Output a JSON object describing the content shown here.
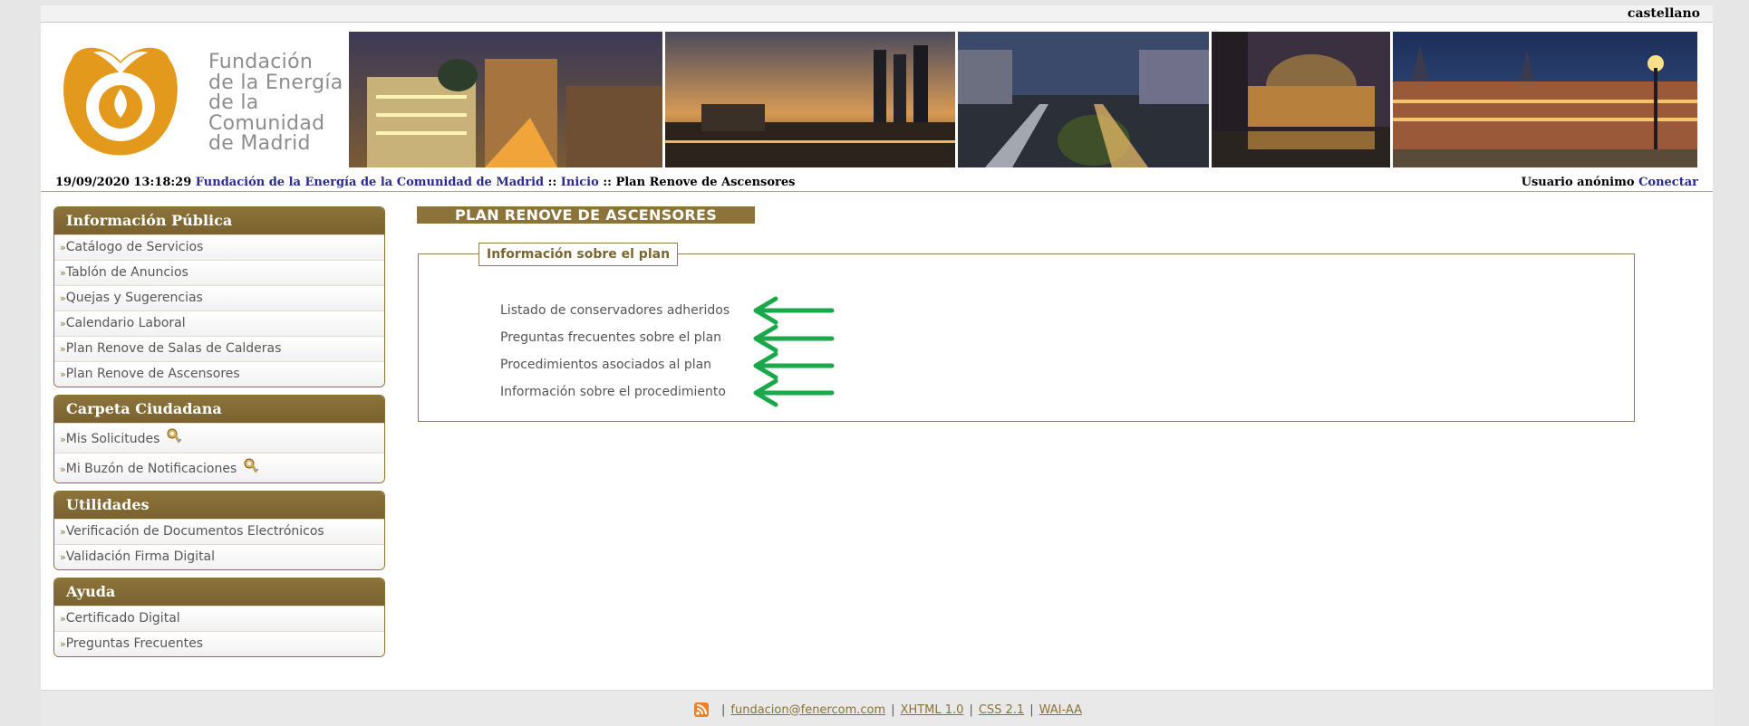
{
  "header": {
    "language_link": "castellano",
    "logo_text": "Fundación\nde la Energía\nde la\nComunidad\nde Madrid",
    "datetime": "19/09/2020 13:18:29",
    "breadcrumb": {
      "home_link": "Fundación de la Energía de la Comunidad de Madrid",
      "sep1": " :: ",
      "inicio_link": "Inicio",
      "sep2": " :: ",
      "current": "Plan Renove de Ascensores"
    },
    "user_label": "Usuario anónimo",
    "login_link": "Conectar"
  },
  "sidebar": {
    "bullet": "»",
    "panels": [
      {
        "title": "Información Pública",
        "items": [
          "Catálogo de Servicios",
          "Tablón de Anuncios",
          "Quejas y Sugerencias",
          "Calendario Laboral",
          "Plan Renove de Salas de Calderas",
          "Plan Renove de Ascensores"
        ]
      },
      {
        "title": "Carpeta Ciudadana",
        "items": [
          "Mis Solicitudes",
          "Mi Buzón de Notificaciones"
        ]
      },
      {
        "title": "Utilidades",
        "items": [
          "Verificación de Documentos Electrónicos",
          "Validación Firma Digital"
        ]
      },
      {
        "title": "Ayuda",
        "items": [
          "Certificado Digital",
          "Preguntas Frecuentes"
        ]
      }
    ]
  },
  "main": {
    "title": "PLAN RENOVE DE ASCENSORES",
    "box_legend": "Información sobre el plan",
    "links": [
      "Listado de conservadores adheridos",
      "Preguntas frecuentes sobre el plan",
      "Procedimientos asociados al plan",
      "Información sobre el procedimiento"
    ],
    "annotation_color": "#1aa84a"
  },
  "footer": {
    "email": "fundacion@fenercom.com",
    "sep": "|",
    "xhtml": "XHTML 1.0",
    "css": "CSS 2.1",
    "wai": "WAI-AA"
  },
  "colors": {
    "brand_gold": "#8c733a",
    "logo_orange": "#e39a1c",
    "link_blue": "#2a2a8a"
  }
}
